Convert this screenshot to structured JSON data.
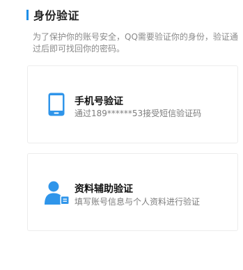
{
  "header": {
    "title": "身份验证"
  },
  "description": "为了保护你的账号安全，QQ需要验证你的身份，验证通过后即可找回你的密码。",
  "methods": [
    {
      "title": "手机号验证",
      "subtitle": "通过189******53接受短信验证码",
      "icon": "mobile-phone-icon"
    },
    {
      "title": "资料辅助验证",
      "subtitle": "填写账号信息与个人资料进行验证",
      "icon": "user-profile-card-icon"
    }
  ],
  "colors": {
    "accent": "#1e8ee8",
    "icon_blue": "#2f95ea",
    "border": "#ececec"
  }
}
